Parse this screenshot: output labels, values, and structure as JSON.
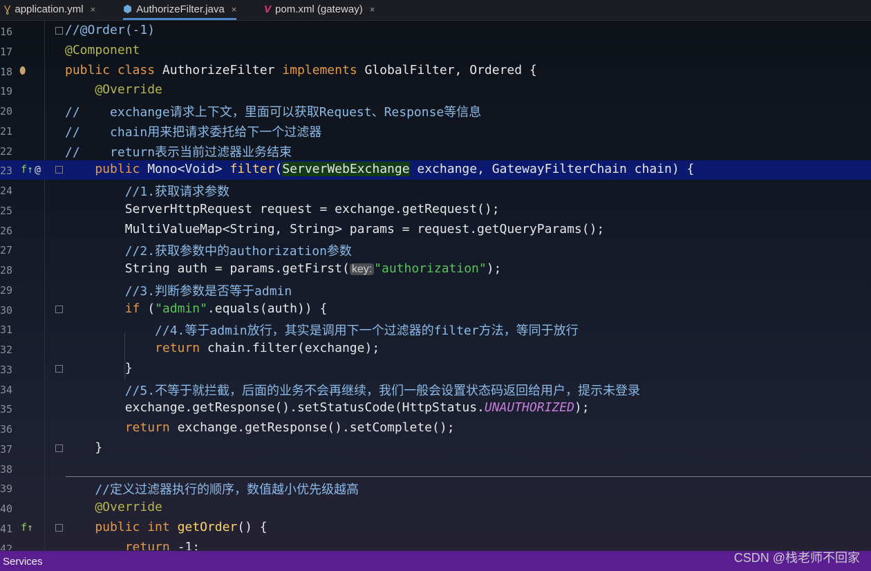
{
  "tabs": [
    {
      "label": "application.yml",
      "icon": "yaml-file-icon",
      "icon_glyph": "Ɣ",
      "active": false
    },
    {
      "label": "AuthorizeFilter.java",
      "icon": "java-class-icon",
      "icon_glyph": "⬢",
      "active": true
    },
    {
      "label": "pom.xml (gateway)",
      "icon": "maven-icon",
      "icon_glyph": "V",
      "active": false
    }
  ],
  "close_glyph": "×",
  "lines": [
    {
      "n": "16",
      "segs": [
        [
          "cm",
          "//@Order(-1)"
        ]
      ]
    },
    {
      "n": "17",
      "segs": [
        [
          "ann",
          "@Component"
        ]
      ]
    },
    {
      "n": "18",
      "segs": [
        [
          "kw",
          "public class "
        ],
        [
          "",
          "AuthorizeFilter "
        ],
        [
          "kw",
          "implements "
        ],
        [
          "",
          "GlobalFilter, Ordered {"
        ]
      ]
    },
    {
      "n": "19",
      "segs": [
        [
          "ann",
          "    @Override"
        ]
      ]
    },
    {
      "n": "20",
      "segs": [
        [
          "cm",
          "//    exchange请求上下文，里面可以获取Request、Response等信息"
        ]
      ]
    },
    {
      "n": "21",
      "segs": [
        [
          "cm",
          "//    chain用来把请求委托给下一个过滤器"
        ]
      ]
    },
    {
      "n": "22",
      "segs": [
        [
          "cm",
          "//    return表示当前过滤器业务结束"
        ]
      ]
    },
    {
      "n": "23",
      "segs": [
        [
          "kw",
          "    public "
        ],
        [
          "",
          "Mono<Void> "
        ],
        [
          "fn",
          "filter"
        ],
        [
          "",
          "("
        ],
        [
          "hlparam",
          "ServerWebExchange"
        ],
        [
          "",
          " exchange, GatewayFilterChain chain) {"
        ]
      ]
    },
    {
      "n": "24",
      "segs": [
        [
          "cm",
          "        //1.获取请求参数"
        ]
      ]
    },
    {
      "n": "25",
      "segs": [
        [
          "",
          "        ServerHttpRequest request = exchange.getRequest();"
        ]
      ]
    },
    {
      "n": "26",
      "segs": [
        [
          "",
          "        MultiValueMap<String, String> params = request.getQueryParams();"
        ]
      ]
    },
    {
      "n": "27",
      "segs": [
        [
          "cm",
          "        //2.获取参数中的authorization参数"
        ]
      ]
    },
    {
      "n": "28",
      "segs": [
        [
          "",
          "        String auth = params.getFirst("
        ],
        [
          "hint",
          "key:"
        ],
        [
          "str",
          "\"authorization\""
        ],
        [
          "",
          ");"
        ]
      ]
    },
    {
      "n": "29",
      "segs": [
        [
          "cm",
          "        //3.判断参数是否等于admin"
        ]
      ]
    },
    {
      "n": "30",
      "segs": [
        [
          "kw",
          "        if "
        ],
        [
          "",
          "("
        ],
        [
          "str",
          "\"admin\""
        ],
        [
          "",
          ".equals(auth)) {"
        ]
      ]
    },
    {
      "n": "31",
      "segs": [
        [
          "cm",
          "            //4.等于admin放行，其实是调用下一个过滤器的filter方法，等同于放行"
        ]
      ]
    },
    {
      "n": "32",
      "segs": [
        [
          "kw",
          "            return "
        ],
        [
          "",
          "chain.filter(exchange);"
        ]
      ]
    },
    {
      "n": "33",
      "segs": [
        [
          "",
          "        }"
        ]
      ]
    },
    {
      "n": "34",
      "segs": [
        [
          "cm",
          "        //5.不等于就拦截，后面的业务不会再继续，我们一般会设置状态码返回给用户，提示未登录"
        ]
      ]
    },
    {
      "n": "35",
      "segs": [
        [
          "",
          "        exchange.getResponse().setStatusCode(HttpStatus."
        ],
        [
          "const",
          "UNAUTHORIZED"
        ],
        [
          "",
          ");"
        ]
      ]
    },
    {
      "n": "36",
      "segs": [
        [
          "kw",
          "        return "
        ],
        [
          "",
          "exchange.getResponse().setComplete();"
        ]
      ]
    },
    {
      "n": "37",
      "segs": [
        [
          "",
          "    }"
        ]
      ]
    },
    {
      "n": "38",
      "segs": []
    },
    {
      "n": "39",
      "segs": [
        [
          "cm",
          "    //定义过滤器执行的顺序，数值越小优先级越高"
        ]
      ]
    },
    {
      "n": "40",
      "segs": [
        [
          "ann",
          "    @Override"
        ]
      ]
    },
    {
      "n": "41",
      "segs": [
        [
          "kw",
          "    public int "
        ],
        [
          "fn",
          "getOrder"
        ],
        [
          "",
          "() {"
        ]
      ]
    },
    {
      "n": "42",
      "segs": [
        [
          "kw",
          "        return "
        ],
        [
          "",
          "-1;"
        ]
      ]
    }
  ],
  "gutter_marks": [
    {
      "line": "18",
      "icon": "implementations-icon",
      "glyph": "⬮"
    },
    {
      "line": "23",
      "icon": "override-method-icon",
      "glyph": "f↑"
    },
    {
      "line": "23b",
      "icon": "annotation-marker-icon",
      "glyph": "@"
    },
    {
      "line": "41",
      "icon": "override-method-icon",
      "glyph": "f↑"
    }
  ],
  "status": {
    "tool_window": "Services",
    "watermark": "CSDN @栈老师不回家"
  },
  "colors": {
    "current_line": "#0b1a6e",
    "keyword": "#e39a4c",
    "comment": "#8db9e6",
    "string": "#5bc25b",
    "status_bar": "#5a1e8f"
  }
}
